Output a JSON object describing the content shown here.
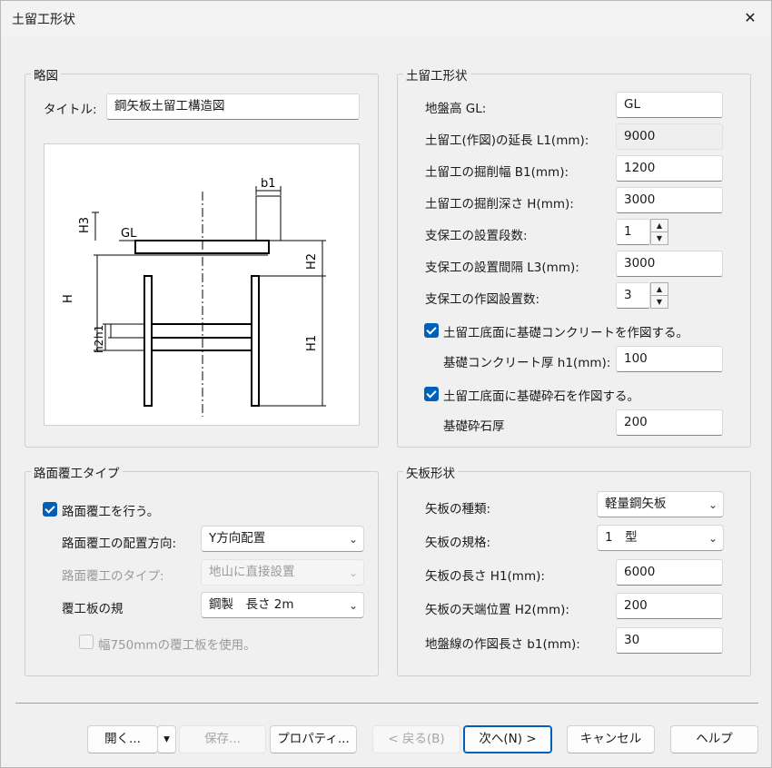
{
  "window": {
    "title": "土留工形状",
    "close_label": "✕"
  },
  "sketch": {
    "group_title": "略図",
    "title_label": "タイトル:",
    "title_value": "鋼矢板土留工構造図",
    "diagram_labels": {
      "b1": "b1",
      "H3": "H3",
      "GL": "GL",
      "H2": "H2",
      "H": "H",
      "h1": "h1",
      "h2": "h2",
      "H1": "H1"
    }
  },
  "shape": {
    "group_title": "土留工形状",
    "fields": [
      {
        "label": "地盤高 GL:",
        "value": "GL"
      },
      {
        "label": "土留工(作図)の延長 L1(mm):",
        "value": "9000"
      },
      {
        "label": "土留工の掘削幅 B1(mm):",
        "value": "1200"
      },
      {
        "label": "土留工の掘削深さ H(mm):",
        "value": "3000"
      },
      {
        "label": "支保工の設置段数:",
        "value": "1"
      },
      {
        "label": "支保工の設置間隔 L3(mm):",
        "value": "3000"
      },
      {
        "label": "支保工の作図設置数:",
        "value": "3"
      }
    ],
    "concrete_check_label": "土留工底面に基礎コンクリートを作図する。",
    "concrete_checked": true,
    "concrete_thickness_label": "基礎コンクリート厚 h1(mm):",
    "concrete_thickness_value": "100",
    "gravel_check_label": "土留工底面に基礎砕石を作図する。",
    "gravel_checked": true,
    "gravel_thickness_label": "基礎砕石厚",
    "gravel_thickness_value": "200"
  },
  "paving": {
    "group_title": "路面覆工タイプ",
    "enable_label": "路面覆工を行う。",
    "enable_checked": true,
    "direction_label": "路面覆工の配置方向:",
    "direction_value": "Y方向配置",
    "type_label": "路面覆工のタイプ:",
    "type_value": "地山に直接設置",
    "plate_label": "覆工板の規",
    "plate_value": "鋼製　長さ 2m",
    "use750_label": "幅750mmの覆工板を使用。",
    "use750_checked": false
  },
  "sheetpile": {
    "group_title": "矢板形状",
    "kind_label": "矢板の種類:",
    "kind_value": "軽量鋼矢板",
    "spec_label": "矢板の規格:",
    "spec_value": "1　型",
    "length_label": "矢板の長さ H1(mm):",
    "length_value": "6000",
    "top_label": "矢板の天端位置 H2(mm):",
    "top_value": "200",
    "ground_line_label": "地盤線の作図長さ b1(mm):",
    "ground_line_value": "30"
  },
  "footer": {
    "open": "開く...",
    "save": "保存...",
    "properties": "プロパティ...",
    "back": "< 戻る(B)",
    "next": "次へ(N) >",
    "cancel": "キャンセル",
    "help": "ヘルプ"
  },
  "icons": {
    "dropdown": "chevron-down-icon",
    "spin_up": "▲",
    "spin_down": "▼",
    "split_arrow": "▾"
  }
}
